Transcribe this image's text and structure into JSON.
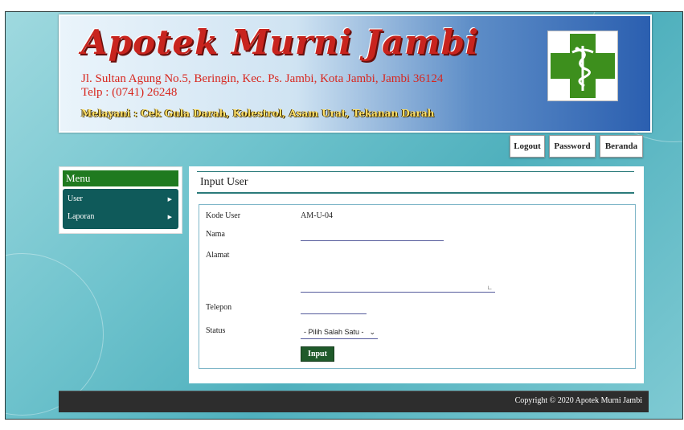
{
  "header": {
    "title": "Apotek Murni Jambi",
    "address": "Jl. Sultan Agung No.5, Beringin, Kec. Ps. Jambi, Kota Jambi, Jambi 36124",
    "phone": "Telp : (0741) 26248",
    "services": "Melayani : Cek Gula Darah, Kolestrol, Asam Urat, Tekanan Darah"
  },
  "top_nav": {
    "logout": "Logout",
    "password": "Password",
    "beranda": "Beranda"
  },
  "sidebar": {
    "title": "Menu",
    "items": [
      {
        "label": "User"
      },
      {
        "label": "Laporan"
      }
    ]
  },
  "content": {
    "title": "Input User",
    "form": {
      "kode_user_label": "Kode User",
      "kode_user_value": "AM-U-04",
      "nama_label": "Nama",
      "nama_value": "",
      "alamat_label": "Alamat",
      "alamat_value": "",
      "telepon_label": "Telepon",
      "telepon_value": "",
      "status_label": "Status",
      "status_selected": "- Pilih Salah Satu -",
      "submit_label": "Input"
    }
  },
  "footer": {
    "copyright": "Copyright © 2020 Apotek Murni Jambi"
  },
  "colors": {
    "menu_head": "#1f7a1f",
    "menu_body": "#0f5a5a",
    "submit": "#1f5a2a",
    "footer": "#2d2d2d",
    "title_red": "#c8241e"
  }
}
